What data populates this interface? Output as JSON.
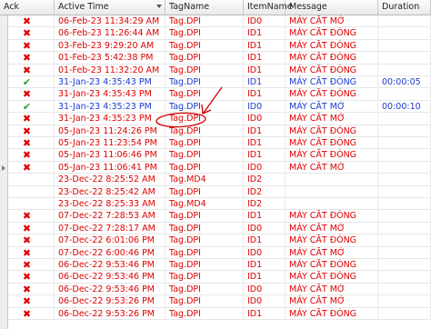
{
  "columns": [
    {
      "key": "ack",
      "label": "Ack"
    },
    {
      "key": "time",
      "label": "Active Time"
    },
    {
      "key": "tag",
      "label": "TagName"
    },
    {
      "key": "item",
      "label": "ItemName"
    },
    {
      "key": "msg",
      "label": "Message"
    },
    {
      "key": "dur",
      "label": "Duration"
    }
  ],
  "rows": [
    {
      "ack": "x",
      "time": "06-Feb-23 11:34:29 AM",
      "tag": "Tag.DPI",
      "item": "ID0",
      "msg": "MÁY CẮT MỞ",
      "dur": "",
      "color": "red"
    },
    {
      "ack": "x",
      "time": "06-Feb-23 11:26:44 AM",
      "tag": "Tag.DPI",
      "item": "ID1",
      "msg": "MÁY CẮT ĐÓNG",
      "dur": "",
      "color": "red"
    },
    {
      "ack": "x",
      "time": "03-Feb-23 9:29:20 AM",
      "tag": "Tag.DPI",
      "item": "ID1",
      "msg": "MÁY CẮT ĐÓNG",
      "dur": "",
      "color": "red"
    },
    {
      "ack": "x",
      "time": "01-Feb-23 5:42:38 PM",
      "tag": "Tag.DPI",
      "item": "ID1",
      "msg": "MÁY CẮT ĐÓNG",
      "dur": "",
      "color": "red"
    },
    {
      "ack": "x",
      "time": "01-Feb-23 11:32:20 AM",
      "tag": "Tag.DPI",
      "item": "ID1",
      "msg": "MÁY CẮT ĐÓNG",
      "dur": "",
      "color": "red"
    },
    {
      "ack": "check",
      "time": "31-Jan-23 4:35:43 PM",
      "tag": "Tag.DPI",
      "item": "ID1",
      "msg": "MÁY CẮT ĐÓNG",
      "dur": "00:00:05",
      "color": "blue"
    },
    {
      "ack": "x",
      "time": "31-Jan-23 4:35:43 PM",
      "tag": "Tag.DPI",
      "item": "ID1",
      "msg": "MÁY CẮT ĐÓNG",
      "dur": "",
      "color": "red"
    },
    {
      "ack": "check",
      "time": "31-Jan-23 4:35:23 PM",
      "tag": "Tag.DPI",
      "item": "ID0",
      "msg": "MÁY CẮT MỞ",
      "dur": "00:00:10",
      "color": "blue"
    },
    {
      "ack": "x",
      "time": "31-Jan-23 4:35:23 PM",
      "tag": "Tag.DPI",
      "item": "ID0",
      "msg": "MÁY CẮT MỞ",
      "dur": "",
      "color": "red"
    },
    {
      "ack": "x",
      "time": "05-Jan-23 11:24:26 PM",
      "tag": "Tag.DPI",
      "item": "ID1",
      "msg": "MÁY CẮT ĐÓNG",
      "dur": "",
      "color": "red"
    },
    {
      "ack": "x",
      "time": "05-Jan-23 11:23:54 PM",
      "tag": "Tag.DPI",
      "item": "ID1",
      "msg": "MÁY CẮT ĐÓNG",
      "dur": "",
      "color": "red"
    },
    {
      "ack": "x",
      "time": "05-Jan-23 11:06:46 PM",
      "tag": "Tag.DPI",
      "item": "ID1",
      "msg": "MÁY CẮT ĐÓNG",
      "dur": "",
      "color": "red"
    },
    {
      "ack": "x",
      "time": "05-Jan-23 11:06:41 PM",
      "tag": "Tag.DPI",
      "item": "ID0",
      "msg": "MÁY CẮT MỞ",
      "dur": "",
      "color": "red"
    },
    {
      "ack": "",
      "time": "23-Dec-22 8:25:52 AM",
      "tag": "Tag.MD4",
      "item": "ID2",
      "msg": "",
      "dur": "",
      "color": "red"
    },
    {
      "ack": "",
      "time": "23-Dec-22 8:25:42 AM",
      "tag": "Tag.DPI",
      "item": "ID2",
      "msg": "",
      "dur": "",
      "color": "red"
    },
    {
      "ack": "",
      "time": "23-Dec-22 8:25:33 AM",
      "tag": "Tag.MD4",
      "item": "ID2",
      "msg": "",
      "dur": "",
      "color": "red"
    },
    {
      "ack": "x",
      "time": "07-Dec-22 7:28:53 AM",
      "tag": "Tag.DPI",
      "item": "ID1",
      "msg": "MÁY CẮT ĐÓNG",
      "dur": "",
      "color": "red"
    },
    {
      "ack": "x",
      "time": "07-Dec-22 7:28:17 AM",
      "tag": "Tag.DPI",
      "item": "ID0",
      "msg": "MÁY CẮT MỞ",
      "dur": "",
      "color": "red"
    },
    {
      "ack": "x",
      "time": "07-Dec-22 6:01:06 PM",
      "tag": "Tag.DPI",
      "item": "ID1",
      "msg": "MÁY CẮT ĐÓNG",
      "dur": "",
      "color": "red"
    },
    {
      "ack": "x",
      "time": "07-Dec-22 6:00:46 PM",
      "tag": "Tag.DPI",
      "item": "ID0",
      "msg": "MÁY CẮT MỞ",
      "dur": "",
      "color": "red"
    },
    {
      "ack": "x",
      "time": "06-Dec-22 9:53:46 PM",
      "tag": "Tag.DPI",
      "item": "ID1",
      "msg": "MÁY CẮT ĐÓNG",
      "dur": "",
      "color": "red"
    },
    {
      "ack": "x",
      "time": "06-Dec-22 9:53:46 PM",
      "tag": "Tag.DPI",
      "item": "ID1",
      "msg": "MÁY CẮT ĐÓNG",
      "dur": "",
      "color": "red"
    },
    {
      "ack": "x",
      "time": "06-Dec-22 9:53:46 PM",
      "tag": "Tag.DPI",
      "item": "ID0",
      "msg": "MÁY CẮT MỞ",
      "dur": "",
      "color": "red"
    },
    {
      "ack": "x",
      "time": "06-Dec-22 9:53:26 PM",
      "tag": "Tag.DPI",
      "item": "ID0",
      "msg": "MÁY CẮT MỞ",
      "dur": "",
      "color": "red"
    },
    {
      "ack": "x",
      "time": "06-Dec-22 9:53:26 PM",
      "tag": "Tag.DPI",
      "item": "ID1",
      "msg": "MÁY CẮT ĐÓNG",
      "dur": "",
      "color": "red"
    }
  ],
  "colors": {
    "red": "#e00000",
    "blue": "#1b3bd1",
    "check": "#2e9e2e",
    "annotation": "#d40000"
  },
  "icons": {
    "x": "close-icon",
    "check": "checkmark-icon"
  }
}
